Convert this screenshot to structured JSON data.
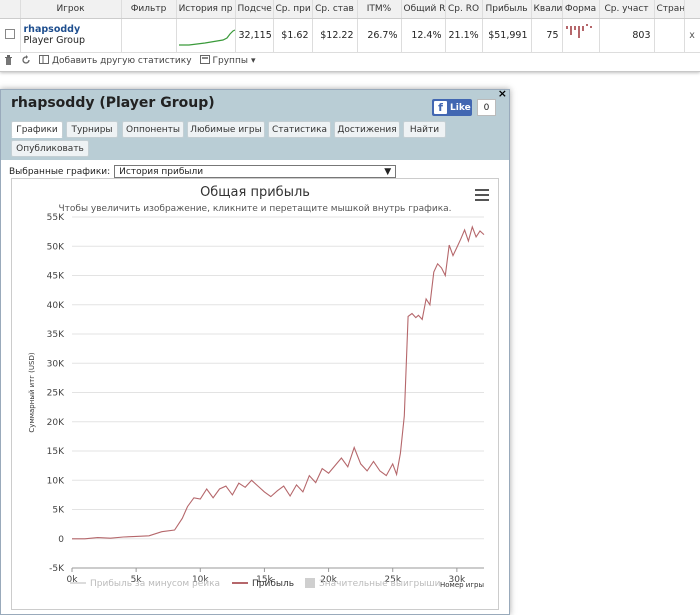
{
  "table": {
    "headers": [
      "",
      "Игрок",
      "Фильтр",
      "История пр",
      "Подсче",
      "Ср. при",
      "Ср. став",
      "ITM%",
      "Общий R",
      "Ср. RO",
      "Прибыль",
      "Квали",
      "Форма",
      "Ср. участ",
      "Стран",
      ""
    ],
    "row": {
      "player_name": "rhapsoddy",
      "group": "Player Group",
      "filter": "",
      "count": "32,115",
      "avg_prize": "$1.62",
      "avg_stake": "$12.22",
      "itm": "26.7%",
      "total_roi": "12.4%",
      "avg_roi": "21.1%",
      "profit": "$51,991",
      "quali": "75",
      "avg_entrants": "803",
      "country": "",
      "remove": "x"
    }
  },
  "toolbar": {
    "add_stat": "Добавить другую статистику",
    "groups": "Группы"
  },
  "panel": {
    "title": "rhapsoddy (Player Group)",
    "fb_like": "Like",
    "fb_count": "0",
    "close": "×",
    "tabs": [
      "Графики",
      "Турниры",
      "Оппоненты",
      "Любимые игры",
      "Статистика",
      "Достижения",
      "Найти",
      "Опубликовать"
    ],
    "selected_charts_label": "Выбранные графики:",
    "selected_chart": "История прибыли"
  },
  "chart_data": {
    "type": "line",
    "title": "Общая прибыль",
    "subtitle": "Чтобы увеличить изображение, кликните и перетащите мышкой внутрь графика.",
    "ylabel": "Суммарный итг (USD)",
    "xlabel": "Номер игры",
    "ylim": [
      -5000,
      55000
    ],
    "xlim": [
      0,
      32115
    ],
    "y_ticks": [
      "-5K",
      "0",
      "5K",
      "10K",
      "15K",
      "20K",
      "25K",
      "30K",
      "35K",
      "40K",
      "45K",
      "50K",
      "55K"
    ],
    "x_ticks": [
      "0k",
      "5k",
      "10k",
      "15k",
      "20k",
      "25k",
      "30k"
    ],
    "grid": true,
    "legend": [
      "Прибыль за минусом рейка",
      "Прибыль",
      "Значительные выигрыши"
    ],
    "series": [
      {
        "name": "Прибыль",
        "color": "#b5676b",
        "x": [
          0,
          1000,
          2000,
          3000,
          4000,
          5000,
          6000,
          7000,
          8000,
          8600,
          9000,
          9500,
          10000,
          10500,
          11000,
          11500,
          12000,
          12500,
          13000,
          13500,
          14000,
          14500,
          15000,
          15500,
          16000,
          16500,
          17000,
          17500,
          18000,
          18500,
          19000,
          19500,
          20000,
          20500,
          21000,
          21500,
          22000,
          22500,
          23000,
          23500,
          24000,
          24500,
          25000,
          25300,
          25600,
          25900,
          26200,
          26500,
          26800,
          27000,
          27300,
          27600,
          27900,
          28200,
          28500,
          28800,
          29100,
          29400,
          29700,
          30000,
          30300,
          30600,
          30900,
          31200,
          31500,
          31800,
          32115
        ],
        "y": [
          0,
          0,
          200,
          100,
          300,
          400,
          500,
          1200,
          1500,
          3500,
          5500,
          7000,
          6800,
          8500,
          7000,
          8500,
          9000,
          7500,
          9500,
          8800,
          10000,
          9000,
          8000,
          7200,
          8200,
          9000,
          7300,
          9200,
          8000,
          10800,
          9600,
          12000,
          11200,
          12500,
          13800,
          12300,
          15600,
          12800,
          11600,
          13200,
          11600,
          10800,
          12800,
          11000,
          14600,
          21000,
          38000,
          38500,
          37800,
          38200,
          37500,
          41000,
          40000,
          45600,
          47000,
          46300,
          45000,
          50200,
          48400,
          49800,
          51200,
          52800,
          50900,
          53300,
          51600,
          52600,
          51991
        ]
      }
    ]
  }
}
